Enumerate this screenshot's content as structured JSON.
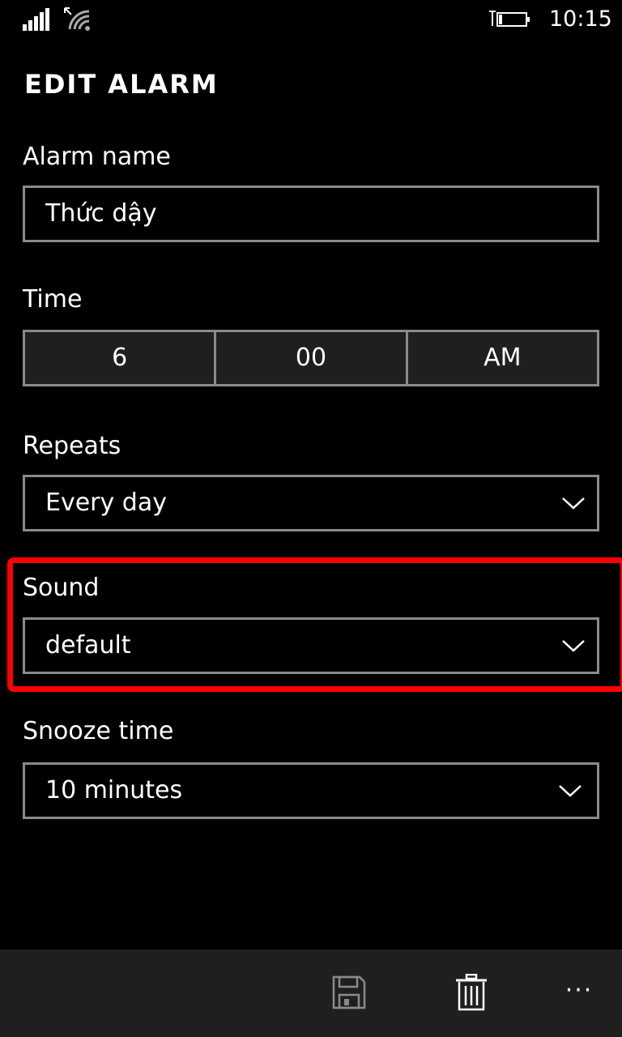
{
  "status_bar": {
    "time": "10:15",
    "icons": [
      "signal-icon",
      "wifi-icon",
      "battery-icon"
    ]
  },
  "page": {
    "title": "EDIT ALARM"
  },
  "alarm_name": {
    "label": "Alarm name",
    "value": "Thức dậy"
  },
  "time": {
    "label": "Time",
    "hour": "6",
    "minute": "00",
    "period": "AM"
  },
  "repeats": {
    "label": "Repeats",
    "value": "Every day"
  },
  "sound": {
    "label": "Sound",
    "value": "default"
  },
  "snooze": {
    "label": "Snooze time",
    "value": "10 minutes"
  },
  "app_bar": {
    "icons": [
      "save-icon",
      "delete-icon",
      "more-icon"
    ],
    "more_glyph": "···"
  },
  "colors": {
    "background": "#000000",
    "app_bar": "#1f1f1f",
    "border": "#8a8a8a",
    "highlight": "#ff0000"
  }
}
